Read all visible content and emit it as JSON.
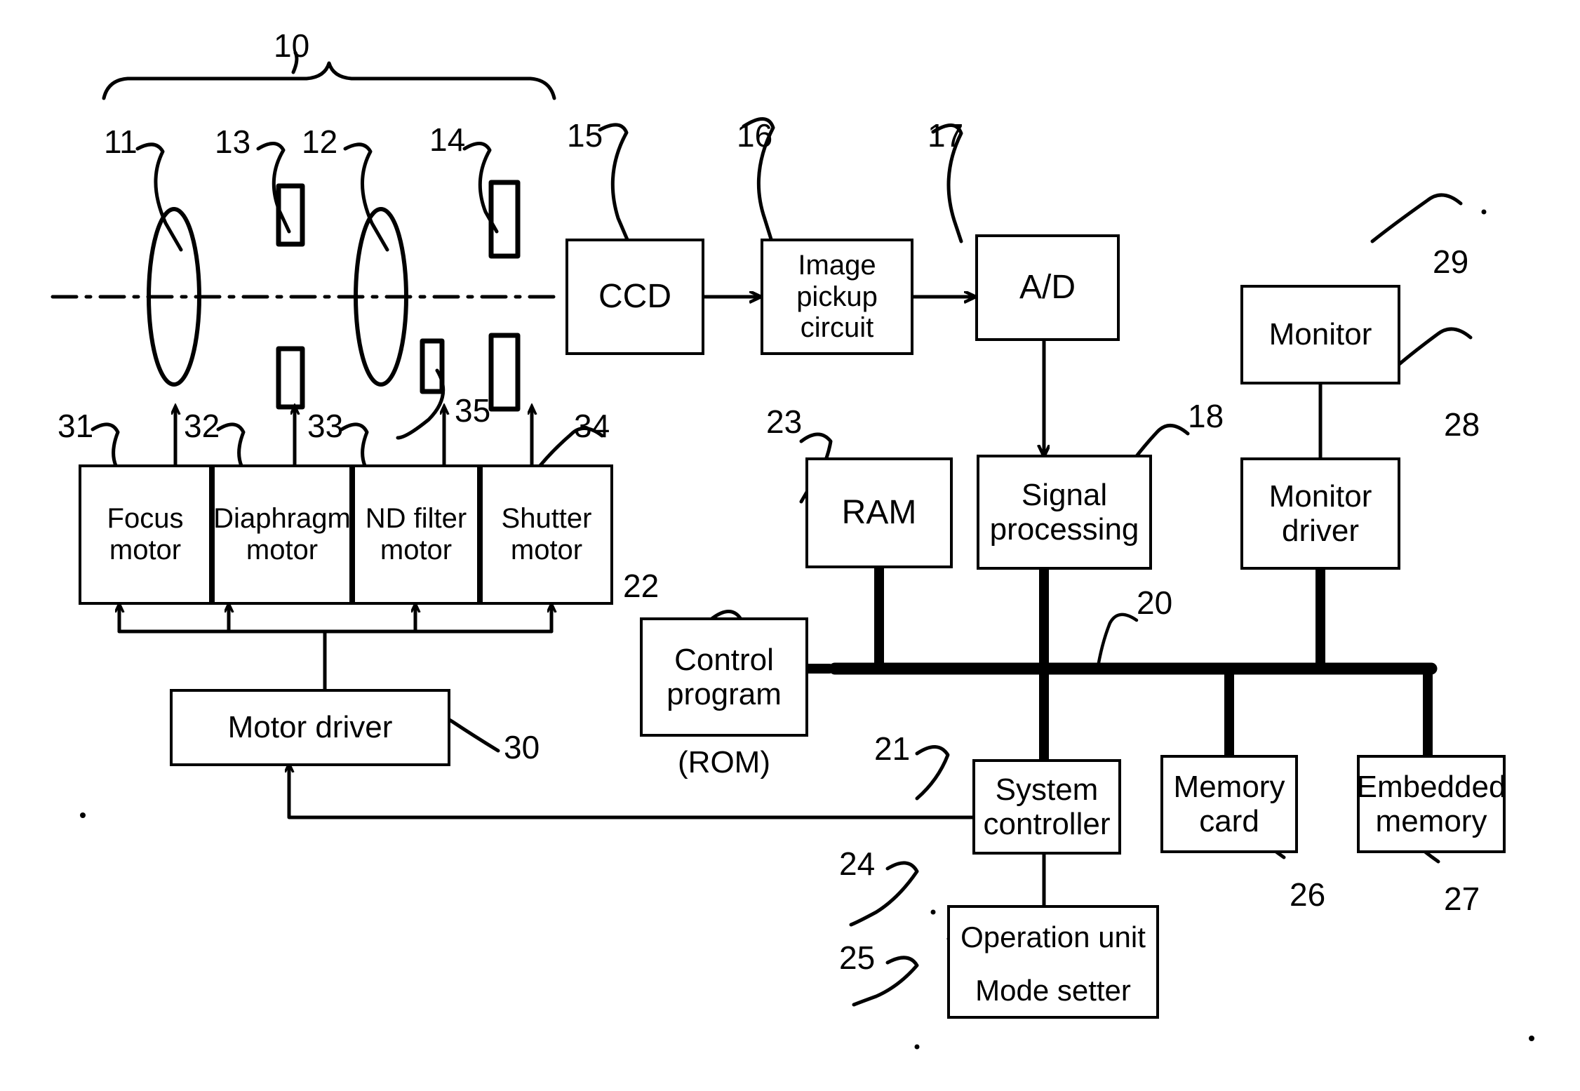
{
  "figure": {
    "kind": "patent-block-diagram",
    "subject": "Digital camera system block diagram"
  },
  "optics": {
    "group_ref": "10",
    "lens_front_ref": "11",
    "lens_rear_ref": "12",
    "diaphragm_ref": "13",
    "shutter_ref": "14",
    "nd_filter_ref": "35"
  },
  "blocks": {
    "ccd": {
      "label": "CCD",
      "ref": "15"
    },
    "image_pickup": {
      "line1": "Image",
      "line2": "pickup",
      "line3": "circuit",
      "ref": "16"
    },
    "ad": {
      "label": "A/D",
      "ref": "17"
    },
    "signal_processing": {
      "line1": "Signal",
      "line2": "processing",
      "ref": "18"
    },
    "ram": {
      "label": "RAM",
      "ref": "23"
    },
    "monitor": {
      "label": "Monitor",
      "ref": "29"
    },
    "monitor_driver": {
      "line1": "Monitor",
      "line2": "driver",
      "ref": "28"
    },
    "control_program": {
      "line1": "Control",
      "line2": "program",
      "caption": "(ROM)",
      "ref": "22"
    },
    "system_controller": {
      "line1": "System",
      "line2": "controller",
      "ref": "21"
    },
    "memory_card": {
      "line1": "Memory",
      "line2": "card",
      "ref": "26"
    },
    "embedded_memory": {
      "line1": "Embedded",
      "line2": "memory",
      "ref": "27"
    },
    "motor_driver": {
      "label": "Motor driver",
      "ref": "30"
    },
    "operation_unit": {
      "label": "Operation unit",
      "ref": "24"
    },
    "mode_setter": {
      "label": "Mode setter",
      "ref": "25"
    },
    "bus": {
      "ref": "20"
    }
  },
  "motors": [
    {
      "line1": "Focus",
      "line2": "motor",
      "ref": "31"
    },
    {
      "line1": "Diaphragm",
      "line2": "motor",
      "ref": "32"
    },
    {
      "line1": "ND",
      "line2": "filter",
      "line3": "motor",
      "ref": "33"
    },
    {
      "line1": "Shutter",
      "line2": "motor",
      "ref": "34"
    }
  ],
  "colors": {
    "ink": "#000000",
    "paper": "#ffffff"
  }
}
